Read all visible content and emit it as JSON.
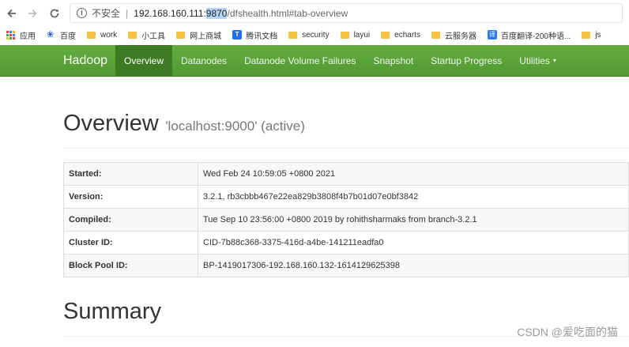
{
  "browser": {
    "security_label": "不安全",
    "separator": "|",
    "url_host": "192.168.160.111:",
    "url_port": "9870",
    "url_path": "/dfshealth.html#tab-overview"
  },
  "bookmarks": [
    {
      "label": "应用",
      "icon": "apps-icon"
    },
    {
      "label": "百度",
      "icon": "paw-icon"
    },
    {
      "label": "work",
      "icon": "folder-icon"
    },
    {
      "label": "小工具",
      "icon": "folder-icon"
    },
    {
      "label": "网上商城",
      "icon": "folder-icon"
    },
    {
      "label": "腾讯文档",
      "icon": "doc-icon"
    },
    {
      "label": "security",
      "icon": "folder-icon"
    },
    {
      "label": "layui",
      "icon": "folder-icon"
    },
    {
      "label": "echarts",
      "icon": "folder-icon"
    },
    {
      "label": "云服务器",
      "icon": "folder-icon"
    },
    {
      "label": "百度翻译-200种语...",
      "icon": "translate-icon"
    },
    {
      "label": "js",
      "icon": "folder-icon"
    }
  ],
  "navbar": {
    "brand": "Hadoop",
    "items": [
      {
        "label": "Overview",
        "active": true
      },
      {
        "label": "Datanodes"
      },
      {
        "label": "Datanode Volume Failures"
      },
      {
        "label": "Snapshot"
      },
      {
        "label": "Startup Progress"
      },
      {
        "label": "Utilities"
      }
    ],
    "caret": "▾"
  },
  "overview": {
    "title": "Overview",
    "subtitle": "'localhost:9000' (active)",
    "rows": [
      {
        "key": "Started:",
        "value": "Wed Feb 24 10:59:05 +0800 2021"
      },
      {
        "key": "Version:",
        "value": "3.2.1, rb3cbbb467e22ea829b3808f4b7b01d07e0bf3842"
      },
      {
        "key": "Compiled:",
        "value": "Tue Sep 10 23:56:00 +0800 2019 by rohithsharmaks from branch-3.2.1"
      },
      {
        "key": "Cluster ID:",
        "value": "CID-7b88c368-3375-416d-a4be-141211eadfa0"
      },
      {
        "key": "Block Pool ID:",
        "value": "BP-1419017306-192.168.160.132-1614129625398"
      }
    ]
  },
  "summary": {
    "title": "Summary"
  },
  "watermark": "CSDN @爱吃面的猫",
  "colors": {
    "navbar": "#5aa338",
    "navbar_active": "#3d7a24",
    "folder": "#f5c242"
  }
}
